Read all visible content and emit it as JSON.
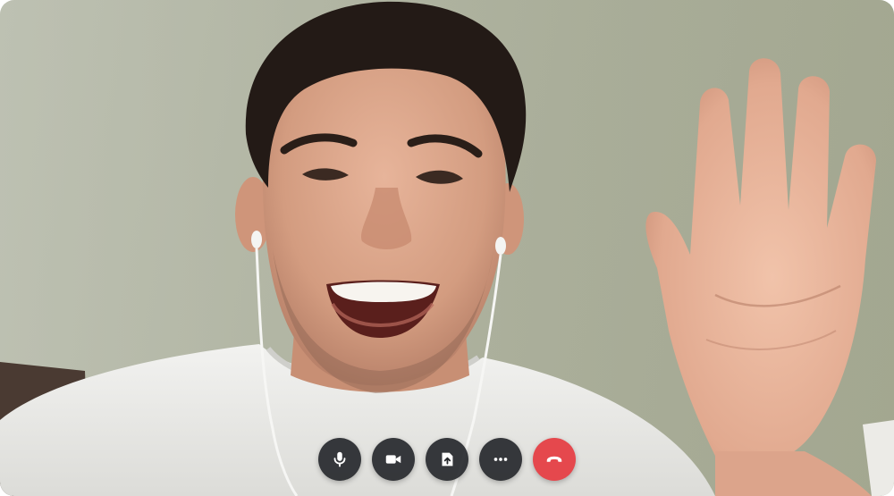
{
  "call": {
    "participant_present": true,
    "controls": [
      {
        "id": "microphone",
        "icon": "microphone-icon",
        "active": true
      },
      {
        "id": "camera",
        "icon": "video-camera-icon",
        "active": true
      },
      {
        "id": "share",
        "icon": "share-screen-icon",
        "active": false
      },
      {
        "id": "more",
        "icon": "more-horizontal-icon",
        "active": false
      },
      {
        "id": "end_call",
        "icon": "hang-up-icon",
        "active": false
      }
    ],
    "colors": {
      "control_dark": "#26282c",
      "end_call": "#e5484d",
      "background_wall": "#aeb29f"
    }
  }
}
